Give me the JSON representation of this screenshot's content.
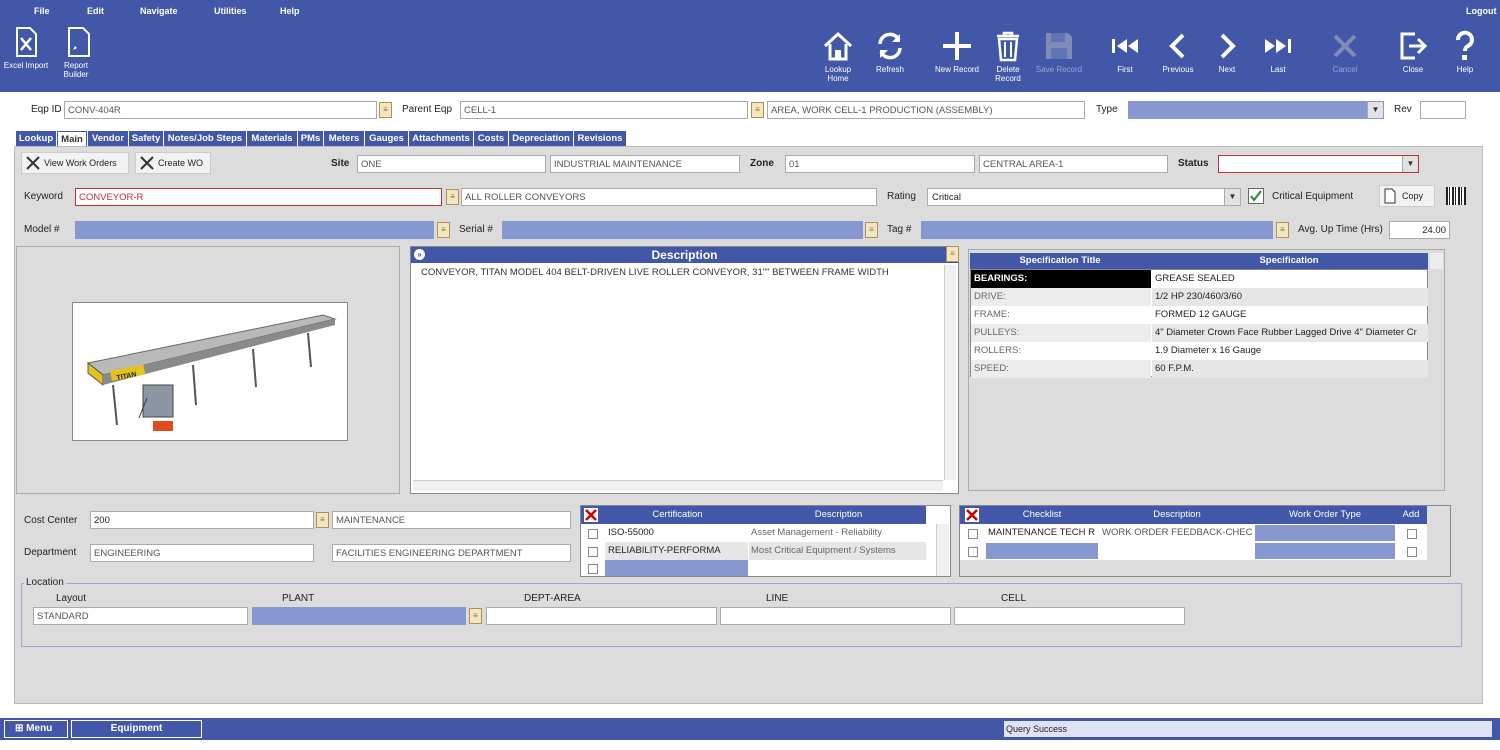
{
  "menu": [
    "File",
    "Edit",
    "Navigate",
    "Utilities",
    "Help"
  ],
  "logout": "Logout",
  "toolbar_left": {
    "excel": "Excel Import",
    "report_l1": "Report",
    "report_l2": "Builder"
  },
  "toolbar": {
    "lookup_l1": "Lookup",
    "lookup_l2": "Home",
    "refresh": "Refresh",
    "new": "New Record",
    "delete_l1": "Delete",
    "delete_l2": "Record",
    "save": "Save Record",
    "first": "First",
    "previous": "Previous",
    "next": "Next",
    "last": "Last",
    "cancel": "Cancel",
    "close": "Close",
    "help": "Help"
  },
  "header": {
    "eqp_label": "Eqp ID",
    "eqp_value": "CONV-404R",
    "parent_label": "Parent Eqp",
    "parent_value": "CELL-1",
    "parent_desc": "AREA, WORK CELL-1  PRODUCTION (ASSEMBLY)",
    "type_label": "Type",
    "rev_label": "Rev"
  },
  "tabs": [
    "Lookup",
    "Main",
    "Vendor",
    "Safety",
    "Notes/Job Steps",
    "Materials",
    "PMs",
    "Meters",
    "Gauges",
    "Attachments",
    "Costs",
    "Depreciation",
    "Revisions"
  ],
  "main": {
    "view_wo": "View Work Orders",
    "create_wo": "Create WO",
    "site_label": "Site",
    "site_value": "ONE",
    "site_desc": "INDUSTRIAL  MAINTENANCE",
    "zone_label": "Zone",
    "zone_value": "01",
    "zone_desc": "CENTRAL AREA-1",
    "status_label": "Status",
    "keyword_label": "Keyword",
    "keyword_value": "CONVEYOR-R",
    "keyword_desc": "ALL ROLLER CONVEYORS",
    "rating_label": "Rating",
    "rating_value": "Critical",
    "critical_label": "Critical Equipment",
    "copy_label": "Copy",
    "model_label": "Model #",
    "serial_label": "Serial #",
    "tag_label": "Tag #",
    "uptime_label": "Avg. Up Time (Hrs)",
    "uptime_value": "24.00",
    "image_brand": "TITAN"
  },
  "description": {
    "title": "Description",
    "text": "CONVEYOR, TITAN MODEL 404 BELT-DRIVEN LIVE ROLLER CONVEYOR, 31\"\" BETWEEN FRAME WIDTH"
  },
  "specs": {
    "col1": "Specification Title",
    "col2": "Specification",
    "rows": [
      {
        "title": "BEARINGS:",
        "value": "GREASE SEALED"
      },
      {
        "title": "DRIVE:",
        "value": "1/2 HP 230/460/3/60"
      },
      {
        "title": "FRAME:",
        "value": "FORMED 12 GAUGE"
      },
      {
        "title": "PULLEYS:",
        "value": "4\" Diameter Crown Face Rubber Lagged Drive 4\" Diameter Cr"
      },
      {
        "title": "ROLLERS:",
        "value": "1.9 Diameter x 16 Gauge"
      },
      {
        "title": "SPEED:",
        "value": "60 F.P.M."
      }
    ]
  },
  "cost": {
    "cost_label": "Cost Center",
    "cost_value": "200",
    "cost_desc": "MAINTENANCE",
    "dept_label": "Department",
    "dept_value": "ENGINEERING",
    "dept_desc": "FACILITIES ENGINEERING DEPARTMENT"
  },
  "certs": {
    "col1": "Certification",
    "col2": "Description",
    "rows": [
      {
        "cert": "ISO-55000",
        "desc": "Asset Management - Reliability"
      },
      {
        "cert": "RELIABILITY-PERFORMA",
        "desc": "Most Critical Equipment / Systems"
      }
    ]
  },
  "checklist": {
    "col1": "Checklist",
    "col2": "Description",
    "col3": "Work Order Type",
    "col4": "Add",
    "rows": [
      {
        "name": "MAINTENANCE TECH R",
        "desc": "WORK ORDER FEEDBACK-CHEC"
      }
    ]
  },
  "location": {
    "legend": "Location",
    "layout_label": "Layout",
    "plant_label": "PLANT",
    "dept_label": "DEPT-AREA",
    "line_label": "LINE",
    "cell_label": "CELL",
    "layout_value": "STANDARD"
  },
  "statusbar": {
    "menu": "Menu",
    "module": "Equipment",
    "message": "Query Success"
  }
}
